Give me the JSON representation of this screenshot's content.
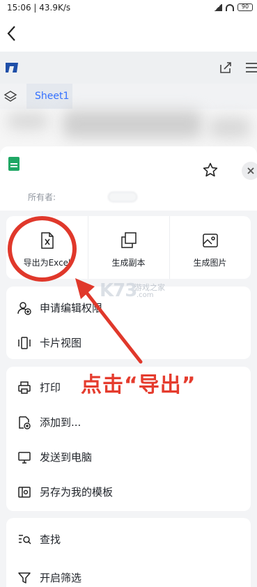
{
  "status_bar": {
    "time_speed": "15:06 | 43.9K/s",
    "battery": "90"
  },
  "doc": {
    "sheet_tab": "Sheet1"
  },
  "sheet_head": {
    "owner_label": "所有者:"
  },
  "quick_actions": [
    {
      "label": "导出为Excel",
      "icon": "excel-export-icon"
    },
    {
      "label": "生成副本",
      "icon": "copy-icon"
    },
    {
      "label": "生成图片",
      "icon": "image-icon"
    }
  ],
  "group1": [
    {
      "label": "申请编辑权限",
      "icon": "user-add-icon"
    },
    {
      "label": "卡片视图",
      "icon": "card-view-icon"
    }
  ],
  "group2": [
    {
      "label": "打印",
      "icon": "printer-icon"
    },
    {
      "label": "添加到...",
      "icon": "add-to-icon"
    },
    {
      "label": "发送到电脑",
      "icon": "monitor-icon"
    },
    {
      "label": "另存为我的模板",
      "icon": "template-icon"
    }
  ],
  "group3": [
    {
      "label": "查找",
      "icon": "search-list-icon"
    },
    {
      "label": "开启筛选",
      "icon": "filter-icon"
    }
  ],
  "annotation": {
    "text": "点击“导出”"
  },
  "watermark": {
    "brand": "K73",
    "cn": "游戏之家",
    "domain": ".com"
  },
  "colors": {
    "accent_blue": "#3370ff",
    "annotation_red": "#e53c2e",
    "excel_green": "#1fa764"
  }
}
